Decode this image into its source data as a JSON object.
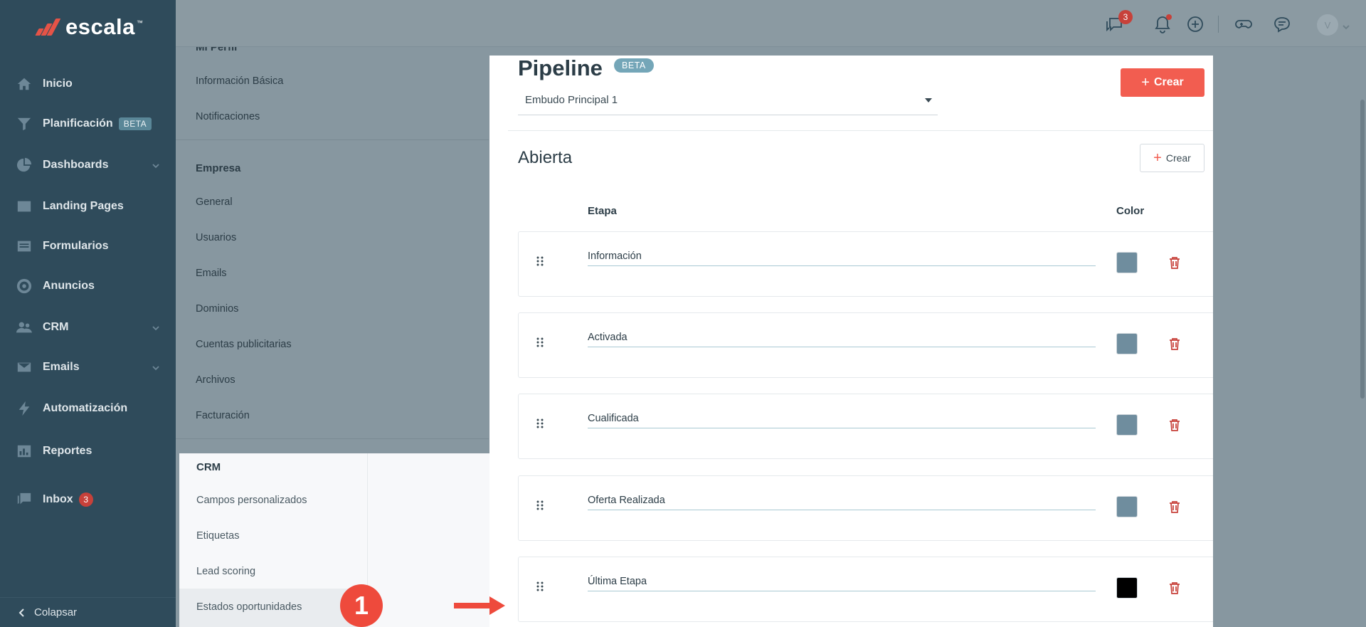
{
  "brand": {
    "name": "escala",
    "tm": "™"
  },
  "sidebar": {
    "items": [
      {
        "label": "Inicio",
        "icon": "home-icon"
      },
      {
        "label": "Planificación",
        "icon": "funnel-icon",
        "badge": "BETA"
      },
      {
        "label": "Dashboards",
        "icon": "pie-chart-icon",
        "expandable": true
      },
      {
        "label": "Landing Pages",
        "icon": "browser-icon"
      },
      {
        "label": "Formularios",
        "icon": "form-icon"
      },
      {
        "label": "Anuncios",
        "icon": "target-icon"
      },
      {
        "label": "CRM",
        "icon": "users-icon",
        "expandable": true
      },
      {
        "label": "Emails",
        "icon": "envelope-icon",
        "expandable": true
      },
      {
        "label": "Automatización",
        "icon": "lightning-icon"
      },
      {
        "label": "Reportes",
        "icon": "bar-chart-icon"
      },
      {
        "label": "Inbox",
        "icon": "chat-icon",
        "count": "3"
      }
    ],
    "collapse_label": "Colapsar"
  },
  "topbar": {
    "messages_count": "3",
    "avatar_initial": "V"
  },
  "settings_menu": {
    "profile_head": "Mi Perfil",
    "profile_links": [
      "Información Básica",
      "Notificaciones"
    ],
    "company_head": "Empresa",
    "company_links": [
      "General",
      "Usuarios",
      "Emails",
      "Dominios",
      "Cuentas publicitarias",
      "Archivos",
      "Facturación"
    ],
    "crm_head": "CRM",
    "crm_links": [
      "Campos personalizados",
      "Etiquetas",
      "Lead scoring",
      "Estados oportunidades"
    ]
  },
  "pipeline": {
    "title": "Pipeline",
    "beta": "BETA",
    "selected": "Embudo Principal 1",
    "create_label": "Crear",
    "section_title": "Abierta",
    "section_create_label": "Crear",
    "col_stage": "Etapa",
    "col_color": "Color",
    "stages": [
      {
        "name": "Información",
        "color": "#6f8d9e"
      },
      {
        "name": "Activada",
        "color": "#6f8d9e"
      },
      {
        "name": "Cualificada",
        "color": "#6f8d9e"
      },
      {
        "name": "Oferta Realizada",
        "color": "#6f8d9e"
      },
      {
        "name": "Última Etapa",
        "color": "#000000"
      }
    ]
  },
  "annotation": {
    "step": "1"
  },
  "colors": {
    "sidebar": "#2f4b5b",
    "accent": "#f25d50",
    "danger": "#c7413a"
  }
}
